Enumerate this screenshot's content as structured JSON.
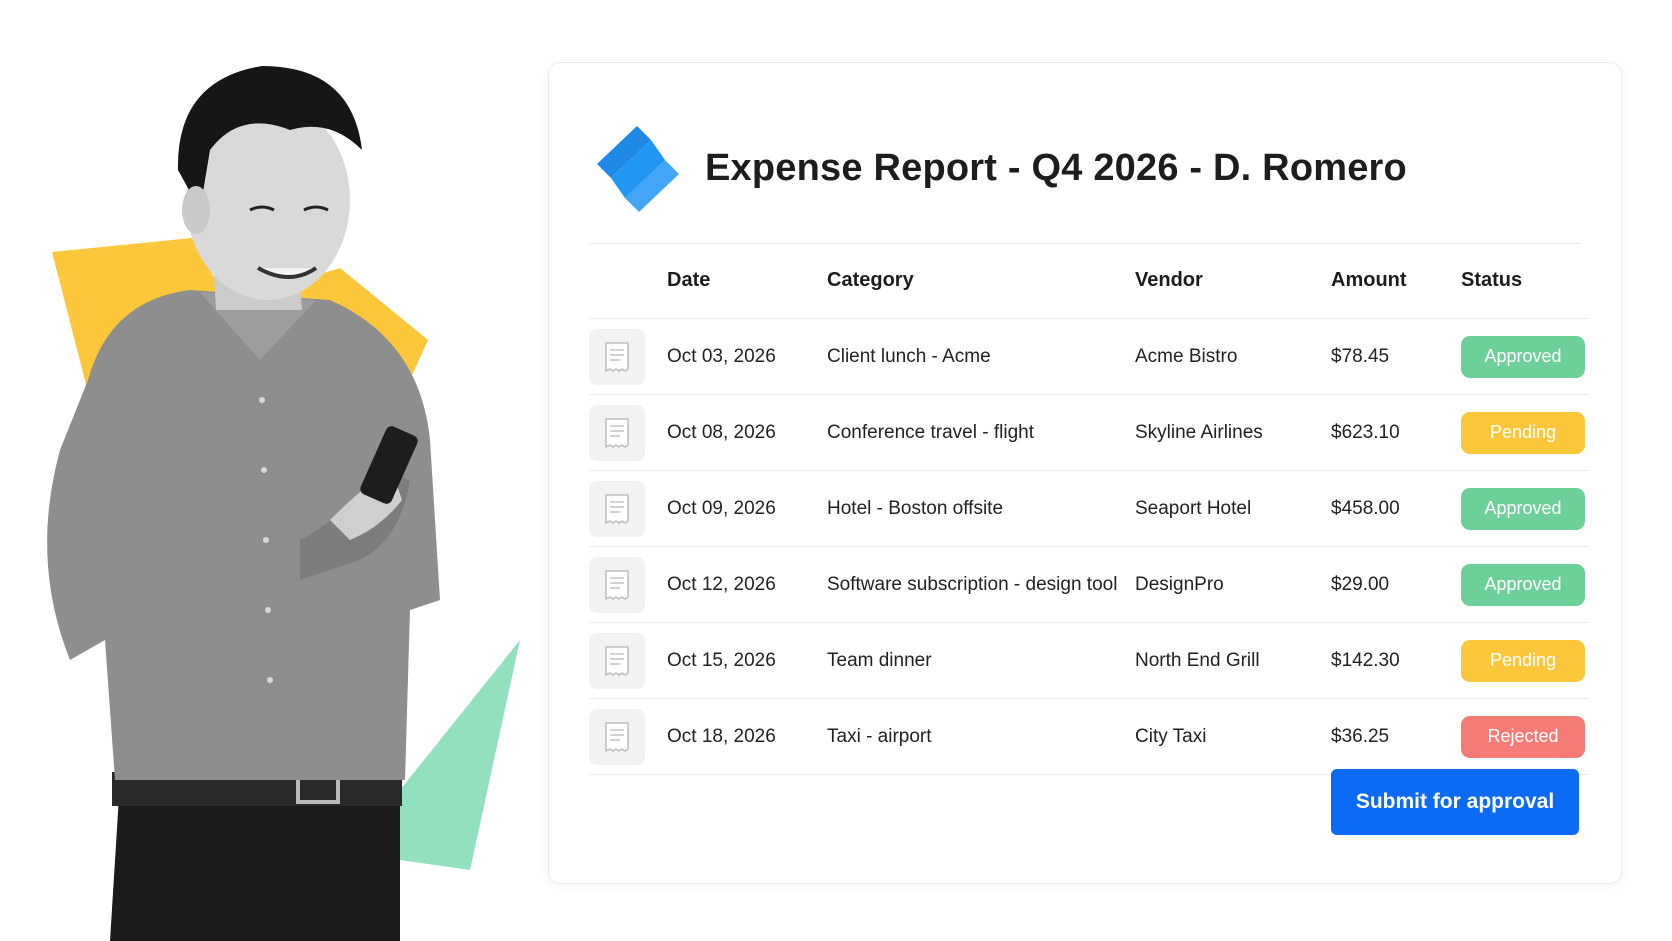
{
  "report": {
    "title": "Expense Report - Q4 2026 - D. Romero",
    "logo_icon": "brand-logo-icon",
    "accent_color": "#0b6bf5"
  },
  "table": {
    "headers": {
      "date": "Date",
      "category": "Category",
      "vendor": "Vendor",
      "amount": "Amount",
      "status": "Status"
    },
    "rows": [
      {
        "date": "Oct 03, 2026",
        "category": "Client lunch - Acme",
        "vendor": "Acme Bistro",
        "amount": "$78.45",
        "status": "Approved",
        "icon": "receipt-icon"
      },
      {
        "date": "Oct 08, 2026",
        "category": "Conference travel - flight",
        "vendor": "Skyline Airlines",
        "amount": "$623.10",
        "status": "Pending",
        "icon": "receipt-icon"
      },
      {
        "date": "Oct 09, 2026",
        "category": "Hotel - Boston offsite",
        "vendor": "Seaport Hotel",
        "amount": "$458.00",
        "status": "Approved",
        "icon": "receipt-icon"
      },
      {
        "date": "Oct 12, 2026",
        "category": "Software subscription - design tool",
        "vendor": "DesignPro",
        "amount": "$29.00",
        "status": "Approved",
        "icon": "receipt-icon"
      },
      {
        "date": "Oct 15, 2026",
        "category": "Team dinner",
        "vendor": "North End Grill",
        "amount": "$142.30",
        "status": "Pending",
        "icon": "receipt-icon"
      },
      {
        "date": "Oct 18, 2026",
        "category": "Taxi - airport",
        "vendor": "City Taxi",
        "amount": "$36.25",
        "status": "Rejected",
        "icon": "receipt-icon"
      }
    ]
  },
  "status_colors": {
    "Approved": "#6dcf9a",
    "Pending": "#fcc73a",
    "Rejected": "#f47b76"
  },
  "actions": {
    "submit_label": "Submit for approval"
  }
}
